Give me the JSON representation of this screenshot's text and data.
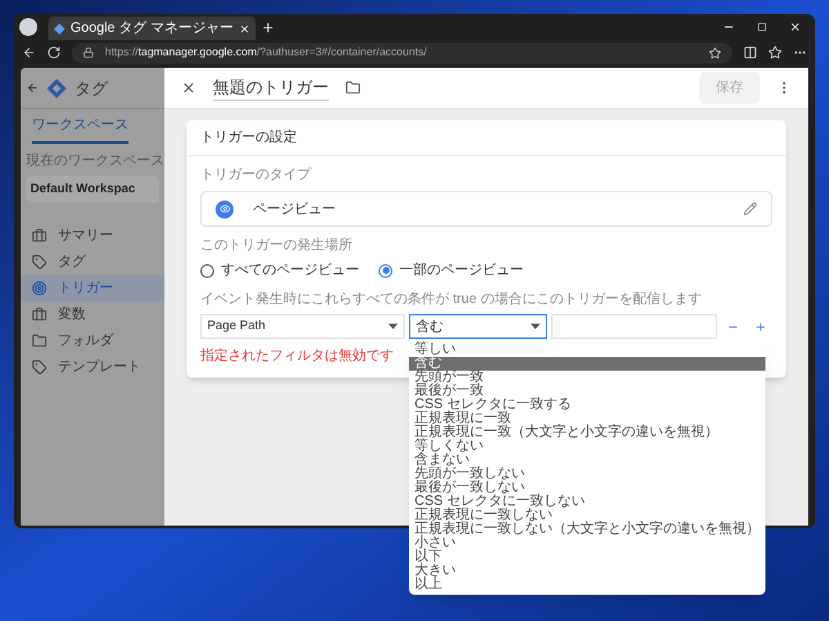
{
  "browser": {
    "tab_title": "Google タグ マネージャー",
    "url": "https://**tagmanager.google.com**/?authuser=3#/container/accounts/"
  },
  "sidebar": {
    "app_title": "タグ",
    "tabs": [
      {
        "label": "ワークスペース",
        "selected": true
      }
    ],
    "workspace_label": "現在のワークスペース",
    "workspace_name": "Default Workspac",
    "items": [
      {
        "label": "サマリー",
        "kind": "briefcase",
        "selected": false
      },
      {
        "label": "タグ",
        "kind": "tag",
        "selected": false
      },
      {
        "label": "トリガー",
        "kind": "trigger",
        "selected": true
      },
      {
        "label": "変数",
        "kind": "briefcase",
        "selected": false
      },
      {
        "label": "フォルダ",
        "kind": "folder",
        "selected": false
      },
      {
        "label": "テンプレート",
        "kind": "template",
        "selected": false
      }
    ]
  },
  "panel": {
    "title": "無題のトリガー",
    "save_button": "保存",
    "card_title": "トリガーの設定",
    "type_label": "トリガーのタイプ",
    "trigger_type": "ページビュー",
    "fire_label": "このトリガーの発生場所",
    "fire_options": [
      {
        "label": "すべてのページビュー",
        "selected": false
      },
      {
        "label": "一部のページビュー",
        "selected": true
      }
    ],
    "conditions_label": "イベント発生時にこれらすべての条件が true の場合にこのトリガーを配信します",
    "condition": {
      "variable": "Page Path",
      "operator": "含む"
    },
    "error": "指定されたフィルタは無効です",
    "operator_options": [
      {
        "label": "等しい",
        "selected": false
      },
      {
        "label": "含む",
        "selected": true
      },
      {
        "label": "先頭が一致",
        "selected": false
      },
      {
        "label": "最後が一致",
        "selected": false
      },
      {
        "label": "CSS セレクタに一致する",
        "selected": false
      },
      {
        "label": "正規表現に一致",
        "selected": false
      },
      {
        "label": "正規表現に一致（大文字と小文字の違いを無視）",
        "selected": false
      },
      {
        "label": "等しくない",
        "selected": false
      },
      {
        "label": "含まない",
        "selected": false
      },
      {
        "label": "先頭が一致しない",
        "selected": false
      },
      {
        "label": "最後が一致しない",
        "selected": false
      },
      {
        "label": "CSS セレクタに一致しない",
        "selected": false
      },
      {
        "label": "正規表現に一致しない",
        "selected": false
      },
      {
        "label": "正規表現に一致しない（大文字と小文字の違いを無視）",
        "selected": false
      },
      {
        "label": "小さい",
        "selected": false
      },
      {
        "label": "以下",
        "selected": false
      },
      {
        "label": "大きい",
        "selected": false
      },
      {
        "label": "以上",
        "selected": false
      }
    ]
  }
}
